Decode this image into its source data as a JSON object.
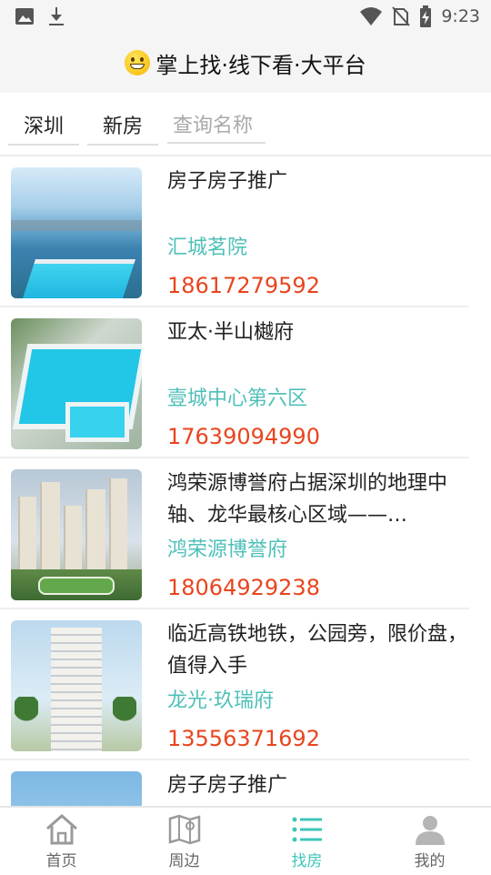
{
  "status_bar": {
    "time": "9:23",
    "left_icons": [
      "image-icon",
      "download-icon"
    ],
    "right_icons": [
      "wifi-icon",
      "no-sim-icon",
      "battery-charging-icon"
    ]
  },
  "header": {
    "title": "掌上找·线下看·大平台",
    "emoji": "grinning-face-icon"
  },
  "filters": {
    "city": "深圳",
    "type": "新房",
    "search_placeholder": "查询名称"
  },
  "listings": [
    {
      "name": "房子房子推广",
      "project": "汇城茗院",
      "phone": "18617279592"
    },
    {
      "name": "亚太·半山樾府",
      "project": "壹城中心第六区",
      "phone": "17639094990"
    },
    {
      "name": "鸿荣源博誉府占据深圳的地理中轴、龙华最核心区域——…",
      "project": "鸿荣源博誉府",
      "phone": "18064929238"
    },
    {
      "name": "临近高铁地铁，公园旁，限价盘，值得入手",
      "project": "龙光·玖瑞府",
      "phone": "13556371692"
    },
    {
      "name": "房子房子推广",
      "project": "",
      "phone": ""
    }
  ],
  "tabs": [
    {
      "label": "首页",
      "icon": "home-icon"
    },
    {
      "label": "周边",
      "icon": "map-icon"
    },
    {
      "label": "找房",
      "icon": "list-icon"
    },
    {
      "label": "我的",
      "icon": "user-icon"
    }
  ],
  "colors": {
    "accent": "#3ec6b8",
    "project_text": "#4fc0b8",
    "phone_text": "#e8451f",
    "header_bg": "#f5f5f5"
  }
}
